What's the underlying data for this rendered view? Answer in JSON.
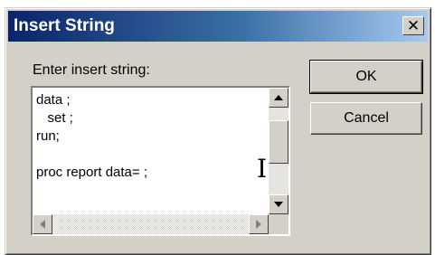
{
  "dialog": {
    "title": "Insert String",
    "close_label": "✕",
    "prompt": "Enter insert string:",
    "text_value": "data ;\n   set ;\nrun;\n\nproc report data= ;",
    "ok_label": "OK",
    "cancel_label": "Cancel"
  },
  "icons": {
    "close": "close-icon",
    "scroll_up": "arrow-up-icon",
    "scroll_down": "arrow-down-icon",
    "scroll_left": "arrow-left-icon",
    "scroll_right": "arrow-right-icon",
    "cursor": "text-cursor-icon"
  },
  "colors": {
    "titlebar_start": "#0a246a",
    "titlebar_end": "#a6caf0",
    "face": "#d4d0c8"
  }
}
